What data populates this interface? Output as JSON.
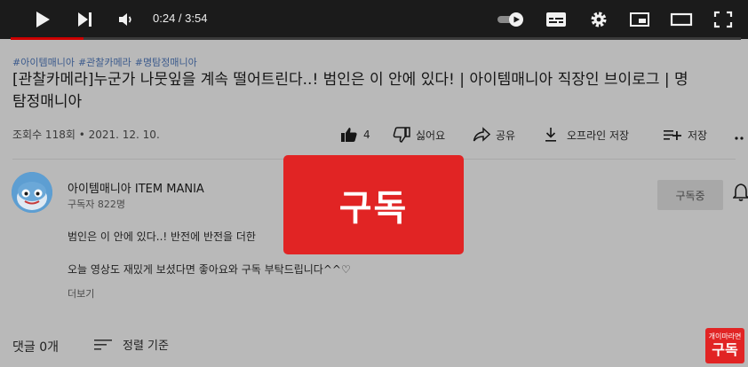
{
  "player": {
    "time_current": "0:24",
    "time_separator": " / ",
    "time_total": "3:54",
    "progress": 0.1,
    "colors": {
      "bar_bg": "#1b1b1b",
      "progress_fill": "#cc0000"
    },
    "icons": [
      "play-icon",
      "next-icon",
      "volume-icon",
      "autoplay-toggle-icon",
      "subtitles-icon",
      "settings-gear-icon",
      "miniplayer-icon",
      "theater-mode-icon",
      "fullscreen-icon"
    ]
  },
  "video": {
    "hashtags": [
      "#아이템매니아",
      "#관찰카메라",
      "#명탐정매니아"
    ],
    "title_line1": "[관찰카메라]누군가 나뭇잎을 계속 떨어트린다..! 범인은 이 안에 있다! | 아이템매니아 직장인 브이로그 | 명",
    "title_line2": "탐정매니아",
    "views": "조회수 118회",
    "date": "2021. 12. 10.",
    "meta_sep": " • "
  },
  "actions": {
    "like_count": "4",
    "dislike_label": "싫어요",
    "share_label": "공유",
    "offline_label": "오프라인 저장",
    "save_label": "저장"
  },
  "channel": {
    "name": "아이템매니아 ITEM MANIA",
    "subscribers": "구독자 822명",
    "subscribed_label": "구독중"
  },
  "description": {
    "line1": "범인은 이 안에 있다..! 반전에 반전을 더한",
    "line2": "오늘 영상도 재밌게 보셨다면 좋아요와 구독 부탁드립니다^^♡",
    "more_label": "더보기"
  },
  "comments": {
    "count_label": "댓글 0개",
    "sort_label": "정렬 기준"
  },
  "overlay": {
    "subscribe_label": "구독",
    "color": "#e12424"
  },
  "watermark": {
    "top_text": "개이마라면",
    "bottom_text": "구독"
  }
}
